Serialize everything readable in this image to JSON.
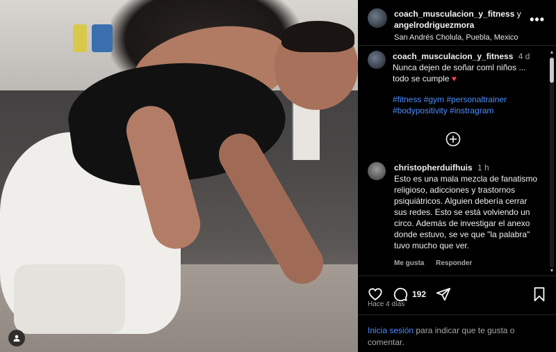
{
  "post": {
    "author_primary": "coach_musculacion_y_fitness",
    "conjunction": "y",
    "author_secondary": "angelrodriguezmora",
    "location": "San Andrés Cholula, Puebla, Mexico",
    "more_icon": "more-horizontal-icon"
  },
  "caption": {
    "user": "coach_musculacion_y_fitness",
    "time": "4 d",
    "text": "Nunca dejen de soñar coml niños ... todo se cumple",
    "emoji": "♥",
    "hashtags_line1": "#fitness #gym #personaltrainer",
    "hashtags_line2": "#bodypositivity #instragram"
  },
  "comment": {
    "user": "christopherduifhuis",
    "time": "1 h",
    "text": "Esto es una mala mezcla de fanatismo religioso, adicciones y trastornos psiquiátricos. Alguien debería cerrar sus redes. Esto se está volviendo un circo. Además de investigar el anexo donde estuvo, se ve que \"la palabra\" tuvo mucho que ver.",
    "like_label": "Me gusta",
    "reply_label": "Responder"
  },
  "actions": {
    "comment_count": "192",
    "date_label": "Hace 4 días"
  },
  "login": {
    "link_text": "Inicia sesión",
    "rest_text": " para indicar que te gusta o comentar."
  },
  "colors": {
    "link": "#4f8fff",
    "heart": "#ff3b5c",
    "muted": "#a8a8a8"
  }
}
